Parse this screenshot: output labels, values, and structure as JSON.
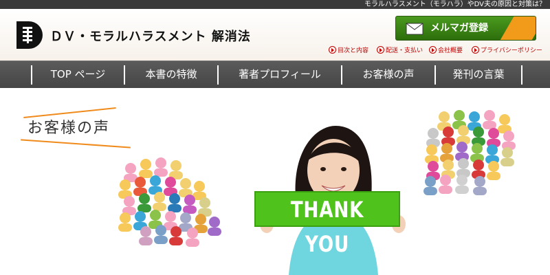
{
  "topbar": {
    "tagline": "モラルハラスメント（モラハラ）やDV夫の原因と対策は？"
  },
  "header": {
    "title": "ＤＶ・モラルハラスメント 解消法",
    "mail_button": "メルマガ登録",
    "links": [
      {
        "label": "目次と内容"
      },
      {
        "label": "配送・支払い"
      },
      {
        "label": "会社概要"
      },
      {
        "label": "プライバシーポリシー"
      }
    ]
  },
  "nav": {
    "items": [
      {
        "label": "TOP ページ"
      },
      {
        "label": "本書の特徴"
      },
      {
        "label": "著者プロフィール"
      },
      {
        "label": "お客様の声"
      },
      {
        "label": "発刊の言葉"
      }
    ]
  },
  "hero": {
    "heading": "お客様の声",
    "sign_text": "THANK YOU"
  },
  "colors": {
    "accent_green": "#4fc21c",
    "accent_orange": "#f08a1a",
    "link_red": "#c00000",
    "nav_bg": "#4f4f4f"
  },
  "icons": [
    "logo-mark",
    "envelope-icon",
    "arrow-circle-icon",
    "people-crowd-icon"
  ]
}
